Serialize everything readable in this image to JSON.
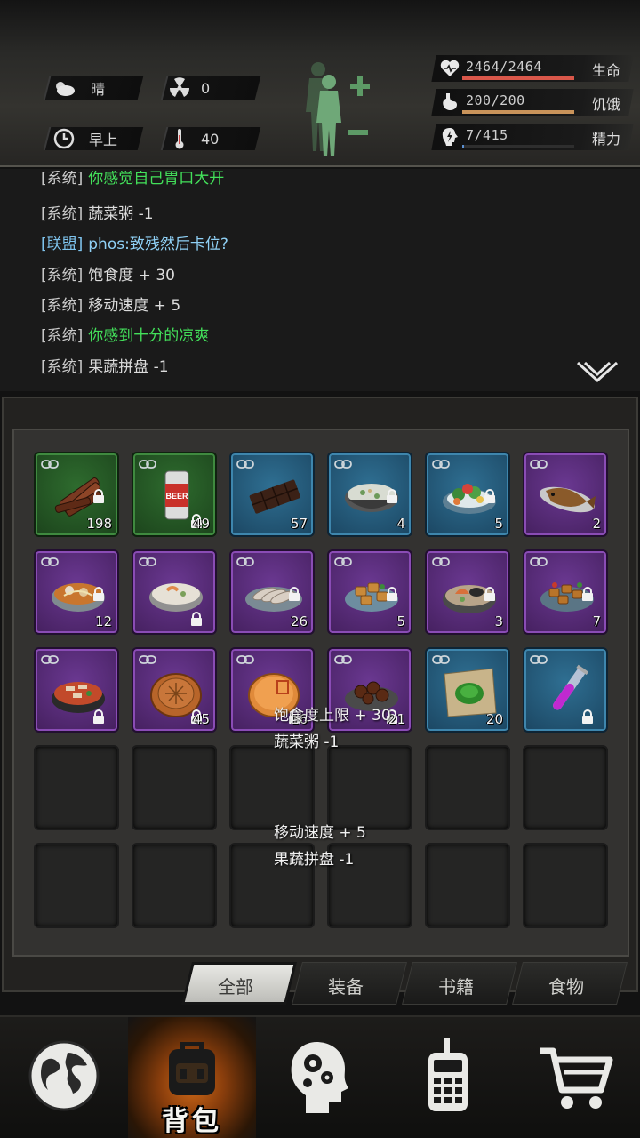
{
  "status": {
    "weather": {
      "icon": "cloud-sun-icon",
      "text": "晴"
    },
    "radiation": {
      "icon": "radiation-icon",
      "value": "0"
    },
    "time_of_day": {
      "icon": "clock-icon",
      "text": "早上"
    },
    "temperature": {
      "icon": "thermometer-icon",
      "value": "40"
    },
    "stats": [
      {
        "name": "health",
        "icon": "heart-pulse-icon",
        "value": "2464/2464",
        "label": "生命",
        "fill": 1.0,
        "color": "#d9574a"
      },
      {
        "name": "hunger",
        "icon": "stomach-icon",
        "value": "200/200",
        "label": "饥饿",
        "fill": 1.0,
        "color": "#c9935a"
      },
      {
        "name": "energy",
        "icon": "brain-bolt-icon",
        "value": "7/415",
        "label": "精力",
        "fill": 0.017,
        "color": "#5b8fd0"
      }
    ]
  },
  "chat": {
    "lines": [
      {
        "tag": "[系统]",
        "text": "你感觉自己胃口大开",
        "style": "green"
      },
      {
        "tag": "[系统]",
        "text": "蔬菜粥 -1",
        "style": "normal"
      },
      {
        "tag": "[联盟]",
        "text": "phos:致残然后卡位?",
        "style": "alliance"
      },
      {
        "tag": "[系统]",
        "text": "饱食度 + 30",
        "style": "normal"
      },
      {
        "tag": "[系统]",
        "text": "移动速度 + 5",
        "style": "normal"
      },
      {
        "tag": "[系统]",
        "text": "你感到十分的凉爽",
        "style": "green"
      },
      {
        "tag": "[系统]",
        "text": "果蔬拼盘 -1",
        "style": "normal"
      }
    ]
  },
  "inventory": {
    "items": [
      {
        "icon": "jerky-icon",
        "rarity": "green",
        "qty": "198",
        "locked": true
      },
      {
        "icon": "beer-can-icon",
        "rarity": "green",
        "qty": "49",
        "locked": true,
        "label": "BEER"
      },
      {
        "icon": "chocolate-bar-icon",
        "rarity": "blue",
        "qty": "57",
        "locked": false
      },
      {
        "icon": "porridge-bowl-icon",
        "rarity": "blue",
        "qty": "4",
        "locked": true
      },
      {
        "icon": "salad-plate-icon",
        "rarity": "blue",
        "qty": "5",
        "locked": true
      },
      {
        "icon": "grilled-fish-icon",
        "rarity": "purple",
        "qty": "2",
        "locked": false
      },
      {
        "icon": "noodle-soup-icon",
        "rarity": "purple",
        "qty": "12",
        "locked": true
      },
      {
        "icon": "seafood-porridge-icon",
        "rarity": "purple",
        "qty": "",
        "locked": true
      },
      {
        "icon": "sliced-meat-icon",
        "rarity": "purple",
        "qty": "26",
        "locked": true
      },
      {
        "icon": "fried-dish-icon",
        "rarity": "purple",
        "qty": "5",
        "locked": true
      },
      {
        "icon": "seafood-bowl-icon",
        "rarity": "purple",
        "qty": "3",
        "locked": true
      },
      {
        "icon": "stir-fry-icon",
        "rarity": "purple",
        "qty": "7",
        "locked": true
      },
      {
        "icon": "hotpot-icon",
        "rarity": "purple",
        "qty": "",
        "locked": true
      },
      {
        "icon": "mooncake-icon",
        "rarity": "purple",
        "qty": "45",
        "locked": true
      },
      {
        "icon": "round-cake-icon",
        "rarity": "purple",
        "qty": "16",
        "locked": true
      },
      {
        "icon": "braised-meat-icon",
        "rarity": "purple",
        "qty": "21",
        "locked": true
      },
      {
        "icon": "herb-paste-icon",
        "rarity": "blue",
        "qty": "20",
        "locked": false
      },
      {
        "icon": "test-tube-icon",
        "rarity": "blue",
        "qty": "",
        "locked": true
      }
    ],
    "empty_slots": 12,
    "floating_text": [
      "饱食度上限 + 30",
      "蔬菜粥 -1",
      "移动速度 + 5",
      "果蔬拼盘 -1"
    ]
  },
  "tabs": [
    {
      "label": "全部",
      "active": true
    },
    {
      "label": "装备",
      "active": false
    },
    {
      "label": "书籍",
      "active": false
    },
    {
      "label": "食物",
      "active": false
    }
  ],
  "nav": [
    {
      "icon": "globe-icon",
      "label": "",
      "active": false
    },
    {
      "icon": "backpack-icon",
      "label": "背包",
      "active": true
    },
    {
      "icon": "head-gears-icon",
      "label": "",
      "active": false
    },
    {
      "icon": "walkie-talkie-icon",
      "label": "",
      "active": false
    },
    {
      "icon": "shopping-cart-icon",
      "label": "",
      "active": false
    }
  ]
}
